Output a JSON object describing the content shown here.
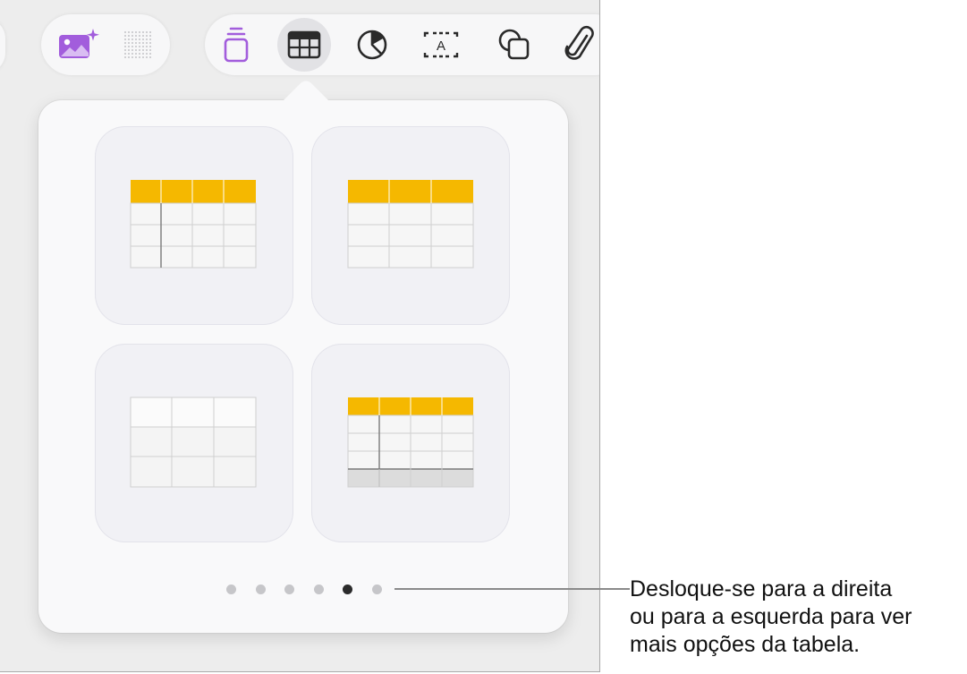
{
  "toolbar": {
    "left_group": [
      {
        "name": "media-generate",
        "icon": "image-sparkle-icon",
        "color": "#a25ddc"
      },
      {
        "name": "grid-dots",
        "icon": "dot-grid-icon"
      }
    ],
    "tools": [
      {
        "name": "insert-sample",
        "icon": "stack-icon",
        "color": "#a25ddc"
      },
      {
        "name": "insert-table",
        "icon": "table-icon",
        "selected": true
      },
      {
        "name": "insert-chart",
        "icon": "chart-pie-icon"
      },
      {
        "name": "insert-text",
        "icon": "text-box-icon",
        "glyph": "A"
      },
      {
        "name": "insert-shape",
        "icon": "shape-icon"
      },
      {
        "name": "insert-media",
        "icon": "paperclip-icon"
      }
    ]
  },
  "table_styles": [
    {
      "name": "header-row-header-column",
      "header_color": "#f5b800"
    },
    {
      "name": "header-row",
      "header_color": "#f5b800"
    },
    {
      "name": "plain",
      "header_color": null
    },
    {
      "name": "header-row-header-column-footer",
      "header_color": "#f5b800"
    }
  ],
  "pagination": {
    "count": 6,
    "current_index": 4
  },
  "callout": {
    "lines": [
      "Desloque-se para a direita",
      "ou para a esquerda para ver",
      "mais opções da tabela."
    ]
  }
}
